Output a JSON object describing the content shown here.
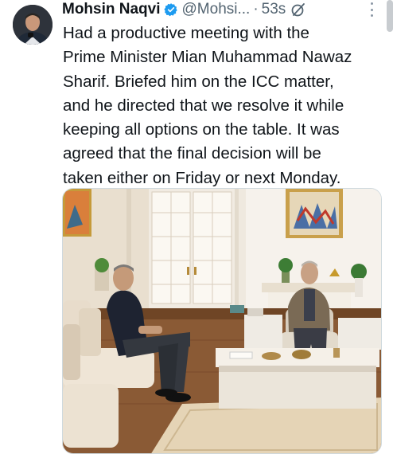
{
  "tweet": {
    "author_name": "Mohsin Naqvi",
    "handle": "@Mohsi...",
    "separator": "·",
    "time": "53s",
    "text": "Had a productive meeting with the\nPrime Minister Mian Muhammad Nawaz\nSharif. Briefed him on the ICC matter,\nand he directed that we resolve it while\nkeeping all options on the table. It was\nagreed that the final decision will be\ntaken either on Friday or next Monday."
  },
  "icons": {
    "verified": "verified-badge-icon",
    "grok": "grok-icon",
    "more": "more-options-icon"
  },
  "colors": {
    "verified_blue": "#1d9bf0",
    "text_primary": "#0f1419",
    "text_secondary": "#536471"
  }
}
